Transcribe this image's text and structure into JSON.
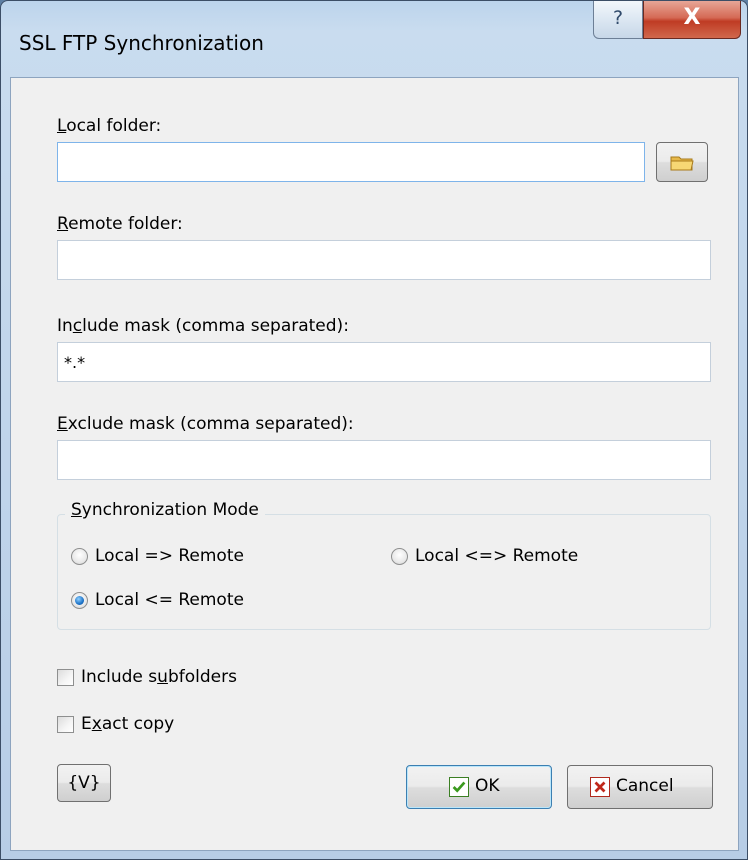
{
  "window": {
    "title": "SSL FTP Synchronization",
    "help_glyph": "?",
    "close_glyph": "X"
  },
  "local_folder": {
    "label_underline": "L",
    "label_rest": "ocal folder:",
    "value": ""
  },
  "remote_folder": {
    "label_underline": "R",
    "label_rest": "emote folder:",
    "value": ""
  },
  "include_mask": {
    "label_pre": "In",
    "label_underline": "c",
    "label_rest": "lude mask (comma separated):",
    "value": "*.*"
  },
  "exclude_mask": {
    "label_underline": "E",
    "label_rest": "xclude mask (comma separated):",
    "value": ""
  },
  "sync_mode": {
    "legend_underline": "S",
    "legend_rest": "ynchronization Mode",
    "options": [
      {
        "label": "Local => Remote",
        "checked": false
      },
      {
        "label": "Local <=> Remote",
        "checked": false
      },
      {
        "label": "Local <= Remote",
        "checked": true
      }
    ]
  },
  "options": {
    "include_subfolders": {
      "label_pre": "Include s",
      "label_underline": "u",
      "label_rest": "bfolders",
      "checked": false
    },
    "exact_copy": {
      "label_pre": "E",
      "label_underline": "x",
      "label_rest": "act copy",
      "checked": false
    }
  },
  "buttons": {
    "variables": "{V}",
    "ok": "OK",
    "cancel": "Cancel"
  },
  "icons": {
    "browse": "folder-icon",
    "ok": "checkmark-icon",
    "cancel": "x-icon",
    "help": "question-icon",
    "close": "close-icon"
  },
  "colors": {
    "ok_icon": "#3b9a1e",
    "cancel_icon": "#c0281b",
    "close_button": "#c8402a"
  }
}
